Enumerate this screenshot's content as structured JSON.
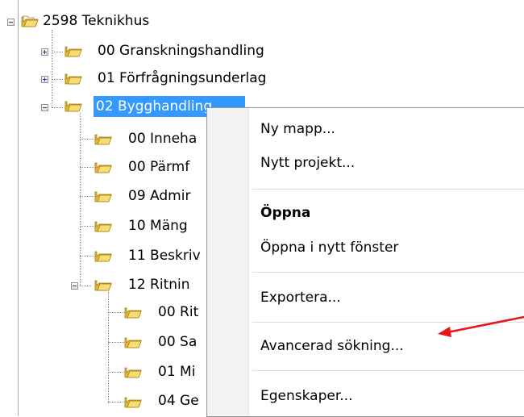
{
  "tree": {
    "root": {
      "label": "2598 Teknikhus",
      "expanded": true
    },
    "level1": [
      {
        "label": "00 Granskningshandling",
        "expanded": false
      },
      {
        "label": "01 Förfrågningsunderlag",
        "expanded": false
      },
      {
        "label": "02 Bygghandling",
        "expanded": true,
        "selected": true
      }
    ],
    "level2": [
      {
        "label": "00 Inneha"
      },
      {
        "label": "00 Pärmf"
      },
      {
        "label": "09 Admir"
      },
      {
        "label": "10 Mäng"
      },
      {
        "label": "11 Beskriv"
      },
      {
        "label": "12 Ritnin",
        "expanded": true
      }
    ],
    "level3": [
      {
        "label": "00 Rit"
      },
      {
        "label": "00 Sa"
      },
      {
        "label": "01 Mi"
      },
      {
        "label": "04 Ge"
      }
    ]
  },
  "context_menu": {
    "items": [
      {
        "label": "Ny mapp...",
        "bold": false
      },
      {
        "label": "Nytt projekt...",
        "bold": false
      },
      {
        "label": "Öppna",
        "bold": true
      },
      {
        "label": "Öppna i nytt fönster",
        "bold": false
      },
      {
        "label": "Exportera...",
        "bold": false
      },
      {
        "label": "Avancerad sökning...",
        "bold": false
      },
      {
        "label": "Egenskaper...",
        "bold": false
      }
    ]
  },
  "colors": {
    "selection": "#3399ff",
    "folder": "#f2cd4a",
    "annotation_arrow": "#e8141b"
  },
  "icons": {
    "folder": "folder-icon",
    "expand": "plus-expander-icon",
    "collapse": "minus-expander-icon"
  }
}
